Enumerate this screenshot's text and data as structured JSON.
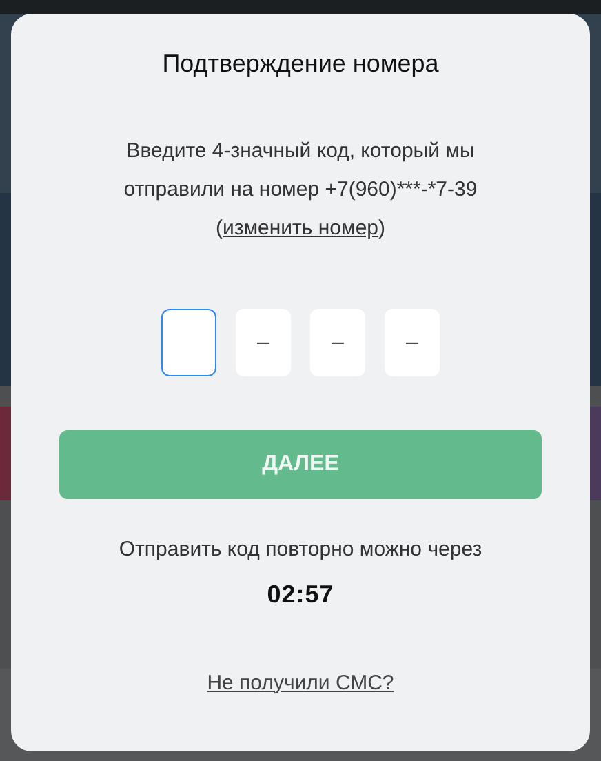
{
  "modal": {
    "title": "Подтверждение номера",
    "message": "Введите 4-значный код, который мы отправили на номер +7(960)***-*7-39",
    "message_link_prefix": "(",
    "change_link": "изменить номер",
    "message_link_suffix": ")",
    "code_inputs": [
      {
        "focused": true
      },
      {
        "focused": false,
        "placeholder": "–"
      },
      {
        "focused": false,
        "placeholder": "–"
      },
      {
        "focused": false,
        "placeholder": "–"
      }
    ],
    "submit_button": {
      "label": "ДАЛЕЕ",
      "disabled": true
    },
    "resend_text": "Отправить код повторно можно через",
    "timer": "02:57",
    "no_sms_link": "Не получили СМС?"
  }
}
